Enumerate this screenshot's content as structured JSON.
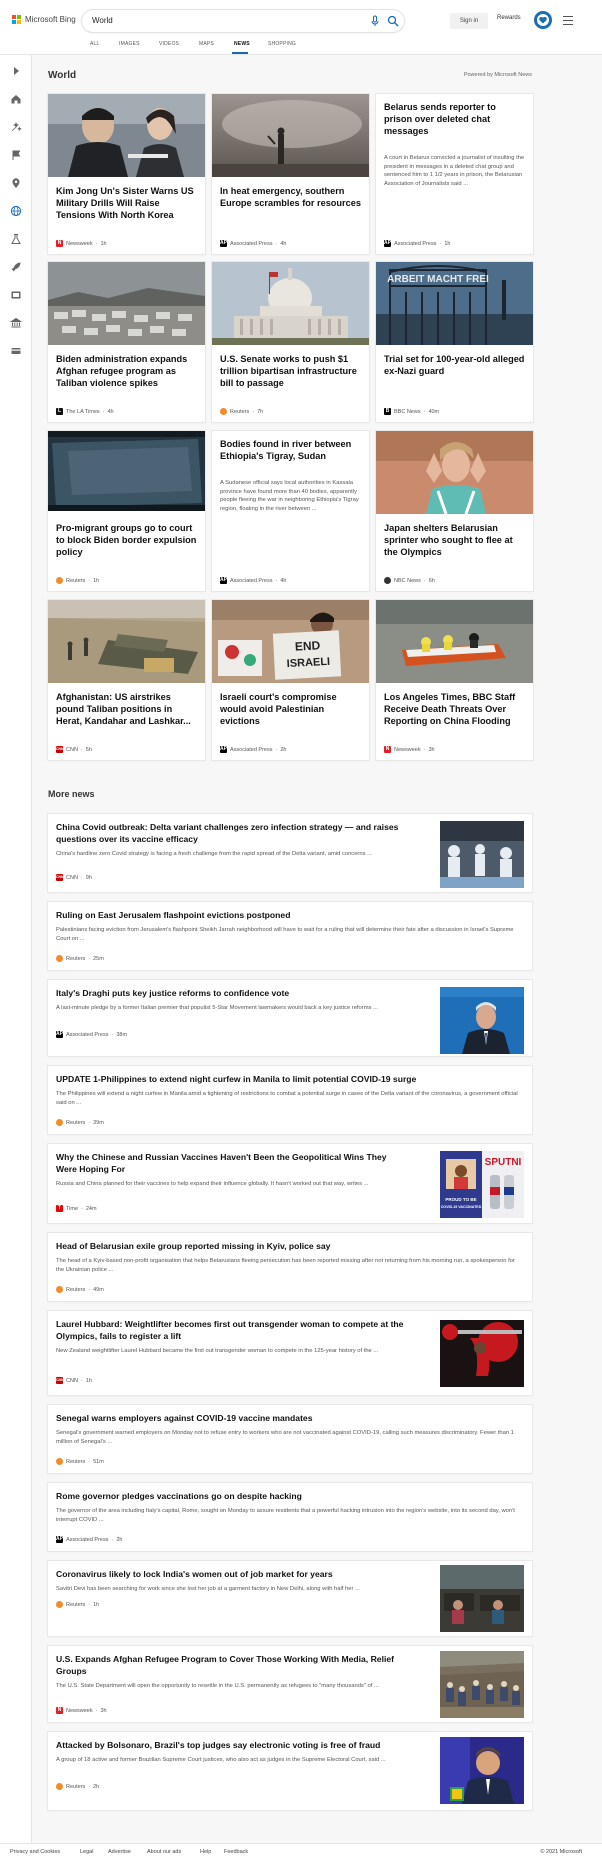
{
  "header": {
    "logo_text": "Microsoft Bing",
    "search_value": "World",
    "signin_label": "Sign in",
    "rewards_label": "Rewards",
    "tabs": [
      "ALL",
      "IMAGES",
      "VIDEOS",
      "MAPS",
      "NEWS",
      "SHOPPING"
    ],
    "active_tab": "NEWS"
  },
  "colors": {
    "accent": "#176bb5",
    "brand_red": "#f25022",
    "brand_green": "#7fba00",
    "brand_blue": "#00a4ef",
    "brand_yellow": "#ffb900"
  },
  "sidebar": {
    "icons": [
      "expand-icon",
      "home-icon",
      "sparkle-icon",
      "flag-icon",
      "location-icon",
      "globe-icon",
      "science-icon",
      "rocket-icon",
      "film-icon",
      "bank-icon",
      "card-icon"
    ]
  },
  "world": {
    "title": "World",
    "powered_by": "Powered by Microsoft News",
    "cards": [
      {
        "title": "Kim Jong Un's Sister Warns US Military Drills Will Raise Tensions With North Korea",
        "source": "Newsweek",
        "time": "1h",
        "image": "photo"
      },
      {
        "title": "In heat emergency, southern Europe scrambles for resources",
        "source": "Associated Press",
        "time": "4h",
        "image": "photo"
      },
      {
        "title": "Belarus sends reporter to prison over deleted chat messages",
        "desc": "A court in Belarus convicted a journalist of insulting the president in messages in a deleted chat group and sentenced him to 1 1/2 years in prison, the Belarusian Association of Journalists said ...",
        "source": "Associated Press",
        "time": "1h",
        "image": "none"
      },
      {
        "title": "Biden administration expands Afghan refugee program as Taliban violence spikes",
        "source": "The LA Times",
        "time": "4h",
        "image": "photo"
      },
      {
        "title": "U.S. Senate works to push $1 trillion bipartisan infrastructure bill to passage",
        "source": "Reuters",
        "time": "7h",
        "image": "photo"
      },
      {
        "title": "Trial set for 100-year-old alleged ex-Nazi guard",
        "source": "BBC News",
        "time": "40m",
        "image": "photo",
        "sign_text": "ARBEIT MACHT FREI"
      },
      {
        "title": "Pro-migrant groups go to court to block Biden border expulsion policy",
        "source": "Reuters",
        "time": "1h",
        "image": "photo"
      },
      {
        "title": "Bodies found in river between Ethiopia's Tigray, Sudan",
        "desc": "A Sudanese official says local authorities in Kassala province have found more than 40 bodies, apparently people fleeing the war in neighboring Ethiopia's Tigray region, floating in the river between ...",
        "source": "Associated Press",
        "time": "4h",
        "image": "none"
      },
      {
        "title": "Japan shelters Belarusian sprinter who sought to flee at the Olympics",
        "source": "NBC News",
        "time": "6h",
        "image": "photo"
      },
      {
        "title": "Afghanistan: US airstrikes pound Taliban positions in Herat, Kandahar and Lashkar...",
        "source": "CNN",
        "time": "5h",
        "image": "photo"
      },
      {
        "title": "Israeli court's compromise would avoid Palestinian evictions",
        "source": "Associated Press",
        "time": "2h",
        "image": "photo",
        "sign_text": "END ISRAELI"
      },
      {
        "title": "Los Angeles Times, BBC Staff Receive Death Threats Over Reporting on China Flooding",
        "source": "Newsweek",
        "time": "3h",
        "image": "photo"
      }
    ]
  },
  "more": {
    "title": "More news",
    "items": [
      {
        "title": "China Covid outbreak: Delta variant challenges zero infection strategy — and raises questions over its vaccine efficacy",
        "desc": "China's hardline zero Covid strategy is facing a fresh challenge from the rapid spread of the Delta variant, amid concerns ...",
        "source": "CNN",
        "time": "9h",
        "thumb": true
      },
      {
        "title": "Ruling on East Jerusalem flashpoint evictions postponed",
        "desc": "Palestinians facing eviction from Jerusalem's flashpoint Sheikh Jarrah neighborhood will have to wait for a ruling that will determine their fate after a discussion in Israel's Supreme Court on ...",
        "source": "Reuters",
        "time": "25m",
        "thumb": false
      },
      {
        "title": "Italy's Draghi puts key justice reforms to confidence vote",
        "desc": "A last-minute pledge by a former Italian premier that populist 5-Star Movement lawmakers would back a key justice reforms ...",
        "source": "Associated Press",
        "time": "38m",
        "thumb": true
      },
      {
        "title": "UPDATE 1-Philippines to extend night curfew in Manila to limit potential COVID-19 surge",
        "desc": "The Philippines will extend a night curfew in Manila amid a tightening of restrictions to combat a potential surge in cases of the Delta variant of the coronavirus, a government official said on ...",
        "source": "Reuters",
        "time": "39m",
        "thumb": false
      },
      {
        "title": "Why the Chinese and Russian Vaccines Haven't Been the Geopolitical Wins They Were Hoping For",
        "desc": "Russia and China planned for their vaccines to help expand their influence globally. It hasn't worked out that way, writes ...",
        "source": "Time",
        "time": "24m",
        "thumb": true,
        "thumb_text": [
          "SPUTNI",
          "PROUD TO BE",
          "COVID-19 VACCINATED"
        ]
      },
      {
        "title": "Head of Belarusian exile group reported missing in Kyiv, police say",
        "desc": "The head of a Kyiv-based non-profit organisation that helps Belarusians fleeing persecution has been reported missing after not returning from his morning run, a spokesperson for the Ukrainian police ...",
        "source": "Reuters",
        "time": "49m",
        "thumb": false
      },
      {
        "title": "Laurel Hubbard: Weightlifter becomes first out transgender woman to compete at the Olympics, fails to register a lift",
        "desc": "New Zealand weightlifter Laurel Hubbard became the first out transgender woman to compete in the 125-year history of the ...",
        "source": "CNN",
        "time": "1h",
        "thumb": true
      },
      {
        "title": "Senegal warns employers against COVID-19 vaccine mandates",
        "desc": "Senegal's government warned employers on Monday not to refuse entry to workers who are not vaccinated against COVID-19, calling such measures discriminatory. Fewer than 1 million of Senegal's ...",
        "source": "Reuters",
        "time": "51m",
        "thumb": false
      },
      {
        "title": "Rome governor pledges vaccinations go on despite hacking",
        "desc": "The governor of the area including Italy's capital, Rome, sought on Monday to assure residents that a powerful hacking intrusion into the region's website, into its second day, won't interrupt COVID ...",
        "source": "Associated Press",
        "time": "2h",
        "thumb": false
      },
      {
        "title": "Coronavirus likely to lock India's women out of job market for years",
        "desc": "Savitri Devi has been searching for work since she lost her job at a garment factory in New Delhi, along with half her ...",
        "source": "Reuters",
        "time": "1h",
        "thumb": true
      },
      {
        "title": "U.S. Expands Afghan Refugee Program to Cover Those Working With Media, Relief Groups",
        "desc": "The U.S. State Department will open the opportunity to resettle in the U.S. permanently as refugees to \"many thousands\" of ...",
        "source": "Newsweek",
        "time": "3h",
        "thumb": true
      },
      {
        "title": "Attacked by Bolsonaro, Brazil's top judges say electronic voting is free of fraud",
        "desc": "A group of 18 active and former Brazilian Supreme Court justices, who also act as judges in the Supreme Electoral Court, said ...",
        "source": "Reuters",
        "time": "2h",
        "thumb": true
      }
    ]
  },
  "footer": {
    "links": [
      "Privacy and Cookies",
      "Legal",
      "Advertise",
      "About our ads",
      "Help",
      "Feedback"
    ],
    "copyright": "© 2021 Microsoft"
  }
}
